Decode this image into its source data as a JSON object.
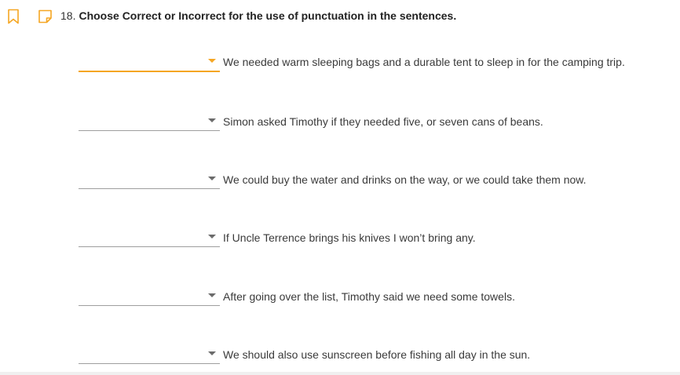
{
  "question": {
    "number": "18.",
    "prompt": "Choose Correct or Incorrect for the use of punctuation in the sentences."
  },
  "icons": {
    "bookmark": "bookmark-icon",
    "note": "note-icon"
  },
  "colors": {
    "accent": "#f5a623",
    "underline": "#9e9e9e",
    "text": "#3a3a3a"
  },
  "items": [
    {
      "selected": "",
      "sentence": "We needed warm sleeping bags and a durable tent to sleep in for the camping trip."
    },
    {
      "selected": "",
      "sentence": "Simon asked Timothy if they needed five, or seven cans of beans."
    },
    {
      "selected": "",
      "sentence": "We could buy the water and drinks on the way, or we could take them now."
    },
    {
      "selected": "",
      "sentence": "If Uncle Terrence brings his knives I won’t bring any."
    },
    {
      "selected": "",
      "sentence": "After going over the list, Timothy said we need some towels."
    },
    {
      "selected": "",
      "sentence": "We should also use sunscreen before fishing all day in the sun."
    }
  ]
}
